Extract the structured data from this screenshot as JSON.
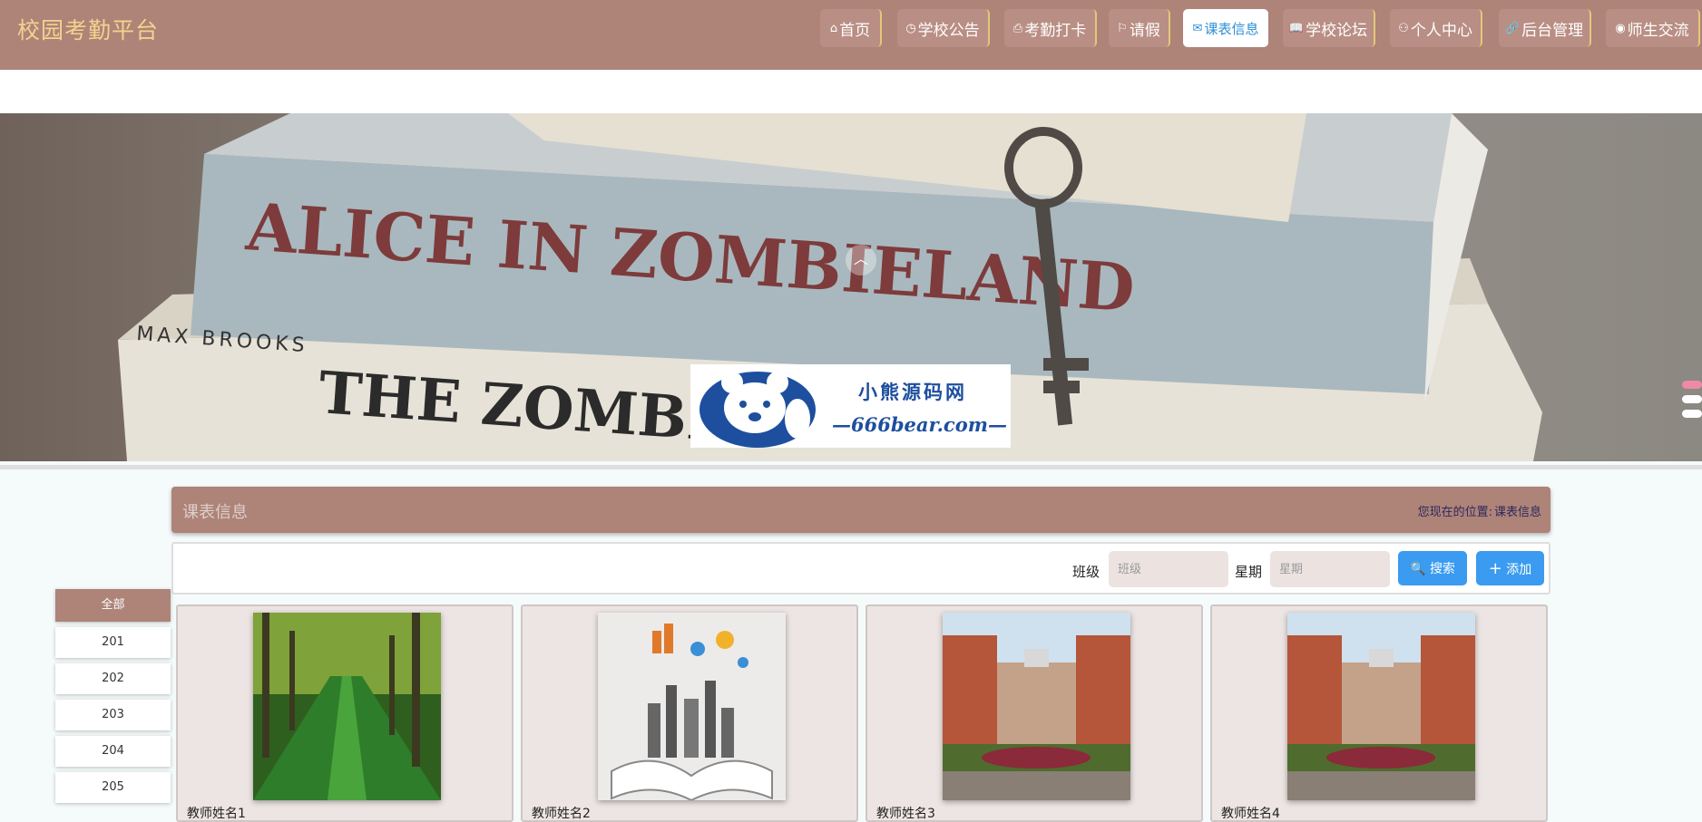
{
  "header": {
    "brand": "校园考勤平台",
    "nav": [
      {
        "label": "首页",
        "icon": "home-icon"
      },
      {
        "label": "学校公告",
        "icon": "clock-icon"
      },
      {
        "label": "考勤打卡",
        "icon": "print-icon"
      },
      {
        "label": "请假",
        "icon": "flag-icon"
      },
      {
        "label": "课表信息",
        "icon": "mail-icon",
        "active": true
      },
      {
        "label": "学校论坛",
        "icon": "book-icon"
      },
      {
        "label": "个人中心",
        "icon": "user-icon"
      },
      {
        "label": "后台管理",
        "icon": "link-icon"
      },
      {
        "label": "师生交流",
        "icon": "chat-icon"
      }
    ]
  },
  "banner": {
    "watermark_line1": "小熊源码网",
    "watermark_line2": "—666bear.com—",
    "slides": 3,
    "active_slide": 1
  },
  "section": {
    "title": "课表信息",
    "breadcrumb_prefix": "您现在的位置:",
    "breadcrumb_current": "课表信息"
  },
  "search": {
    "class_label": "班级",
    "class_placeholder": "班级",
    "weekday_label": "星期",
    "weekday_placeholder": "星期",
    "search_button": "搜索",
    "add_button": "添加"
  },
  "class_filter": {
    "items": [
      "全部",
      "201",
      "202",
      "203",
      "204",
      "205"
    ],
    "active": "全部"
  },
  "cards": [
    {
      "name": "教师姓名1",
      "image": "tree-road"
    },
    {
      "name": "教师姓名2",
      "image": "book-city"
    },
    {
      "name": "教师姓名3",
      "image": "school-building"
    },
    {
      "name": "教师姓名4",
      "image": "school-building"
    }
  ],
  "colors": {
    "header_bg": "#ae8378",
    "brand_text": "#f3d28f",
    "active_nav_text": "#2d8fd6",
    "button_blue": "#3a9bf0"
  }
}
